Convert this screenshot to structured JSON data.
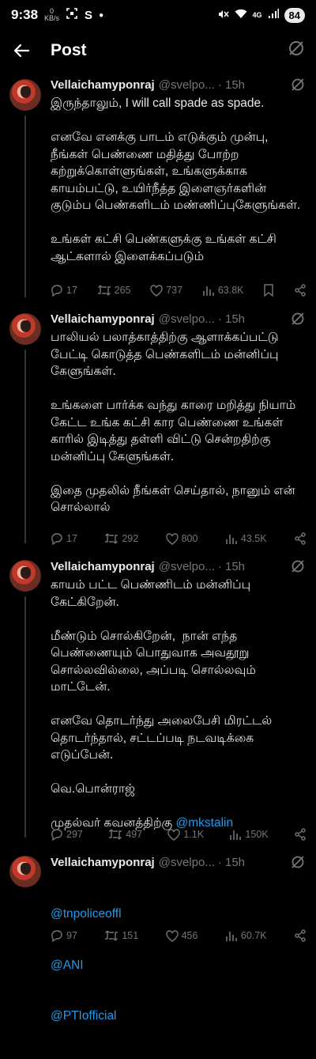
{
  "statusbar": {
    "time": "9:38",
    "data_rate": "0",
    "data_unit": "KB/s",
    "network": "4G",
    "battery": "84"
  },
  "header": {
    "title": "Post"
  },
  "tweets": [
    {
      "name": "Vellaichamyponraj",
      "handle": "@svelpo...",
      "time": "· 15h",
      "text": "இருந்தாலும், I will call spade as spade.\n\nஎனவே எனக்கு பாடம் எடுக்கும் முன்பு, நீங்கள் பெண்ணை மதித்து போற்ற கற்றுக்கொள்ளுங்கள், உங்களுக்காக காயம்பட்டு, உயிர்நீத்த இளைஞர்களின் குடும்ப பெண்களிடம் மண்ணிப்புகேளுங்கள்.\n\nஉங்கள் கட்சி பெண்களுக்கு உங்கள் கட்சி ஆட்களால் இளைக்கப்படும்",
      "replies": "17",
      "reposts": "265",
      "likes": "737",
      "views": "63.8K"
    },
    {
      "name": "Vellaichamyponraj",
      "handle": "@svelpo...",
      "time": "· 15h",
      "text": "பாலியல் பலாத்காத்திற்கு ஆளாக்கப்பட்டு பேட்டி கொடுத்த பெண்களிடம் மன்னிப்பு கேளுங்கள்.\n\nஉங்களை பார்க்க வந்து காரை மறித்து நியாம் கேட்ட உங்க கட்சி கார பெண்ணை உங்கள் காரில் இடித்து தள்ளி விட்டு சென்றதிற்கு மன்னிப்பு கேளுங்கள்.\n\nஇதை முதலில் நீங்கள் செய்தால், நானும் என் சொல்லால்",
      "replies": "17",
      "reposts": "292",
      "likes": "800",
      "views": "43.5K"
    },
    {
      "name": "Vellaichamyponraj",
      "handle": "@svelpo...",
      "time": "· 15h",
      "text": "காயம் பட்ட பெண்ணிடம் மன்னிப்பு கேட்கிறேன்.\n\nமீண்டும் சொல்கிறேன்,  நான் எந்த பெண்ணையும் பொதுவாக அவதூறு சொல்லவில்லை, அப்படி சொல்லவும் மாட்டேன்.\n\nஎனவே தொடர்ந்து அலைபேசி மிரட்டல் தொடர்ந்தால், சட்டப்படி நடவடிக்கை எடுப்பேன்.\n\nவெ.பொன்ராஜ்\n\nமுதல்வர் கவனத்திற்கு ",
      "mention": "@mkstalin",
      "replies": "297",
      "reposts": "497",
      "likes": "1.1K",
      "views": "150K"
    },
    {
      "name": "Vellaichamyponraj",
      "handle": "@svelpo...",
      "time": "· 15h",
      "mentions": [
        "@tnpoliceoffl",
        "@ANI",
        "@PTIofficial"
      ],
      "replies": "97",
      "reposts": "151",
      "likes": "456",
      "views": "60.7K"
    }
  ],
  "icons": {
    "back": "arrow-left-icon",
    "grok": "grok-icon",
    "reply": "reply-icon",
    "repost": "repost-icon",
    "like": "heart-icon",
    "views": "views-icon",
    "bookmark": "bookmark-icon",
    "share": "share-icon"
  },
  "colors": {
    "background": "#000000",
    "text": "#e7e9ea",
    "secondary": "#71767b",
    "link": "#1d9bf0"
  }
}
